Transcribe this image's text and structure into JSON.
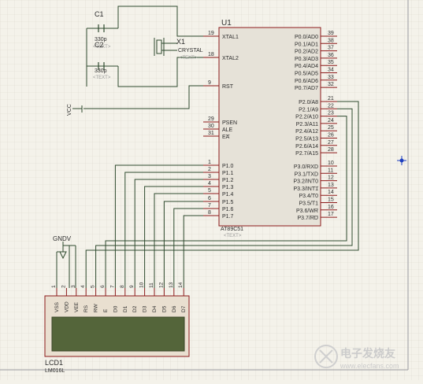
{
  "u1": {
    "ref": "U1",
    "part": "AT89C51",
    "text_placeholder": "<TEXT>",
    "left_pins": [
      {
        "num": "19",
        "name": "XTAL1"
      },
      {
        "num": "18",
        "name": "XTAL2"
      },
      {
        "num": "9",
        "name": "RST"
      },
      {
        "num": "29",
        "name": "PSEN"
      },
      {
        "num": "30",
        "name": "ALE"
      },
      {
        "num": "31",
        "name": "EA"
      },
      {
        "num": "1",
        "name": "P1.0"
      },
      {
        "num": "2",
        "name": "P1.1"
      },
      {
        "num": "3",
        "name": "P1.2"
      },
      {
        "num": "4",
        "name": "P1.3"
      },
      {
        "num": "5",
        "name": "P1.4"
      },
      {
        "num": "6",
        "name": "P1.5"
      },
      {
        "num": "7",
        "name": "P1.6"
      },
      {
        "num": "8",
        "name": "P1.7"
      }
    ],
    "right_pins": [
      {
        "num": "39",
        "name": "P0.0/AD0"
      },
      {
        "num": "38",
        "name": "P0.1/AD1"
      },
      {
        "num": "37",
        "name": "P0.2/AD2"
      },
      {
        "num": "36",
        "name": "P0.3/AD3"
      },
      {
        "num": "35",
        "name": "P0.4/AD4"
      },
      {
        "num": "34",
        "name": "P0.5/AD5"
      },
      {
        "num": "33",
        "name": "P0.6/AD6"
      },
      {
        "num": "32",
        "name": "P0.7/AD7"
      },
      {
        "num": "21",
        "name": "P2.0/A8"
      },
      {
        "num": "22",
        "name": "P2.1/A9"
      },
      {
        "num": "23",
        "name": "P2.2/A10"
      },
      {
        "num": "24",
        "name": "P2.3/A11"
      },
      {
        "num": "25",
        "name": "P2.4/A12"
      },
      {
        "num": "26",
        "name": "P2.5/A13"
      },
      {
        "num": "27",
        "name": "P2.6/A14"
      },
      {
        "num": "28",
        "name": "P2.7/A15"
      },
      {
        "num": "10",
        "name": "P3.0/RXD"
      },
      {
        "num": "11",
        "name": "P3.1/TXD"
      },
      {
        "num": "12",
        "name": "P3.2/INT0"
      },
      {
        "num": "13",
        "name": "P3.3/INT1"
      },
      {
        "num": "14",
        "name": "P3.4/T0"
      },
      {
        "num": "15",
        "name": "P3.5/T1"
      },
      {
        "num": "16",
        "name": "P3.6/WR"
      },
      {
        "num": "17",
        "name": "P3.7/RD"
      }
    ]
  },
  "c1": {
    "ref": "C1",
    "value": "330p",
    "text": "<TEXT>"
  },
  "c2": {
    "ref": "C2",
    "value": "330p",
    "text": "<TEXT>"
  },
  "x1": {
    "ref": "X1",
    "value": "CRYSTAL",
    "text": "<TEXT>"
  },
  "vcc_label": "VCC",
  "gnd_label": "GNDV",
  "lcd": {
    "ref": "LCD1",
    "part": "LM016L",
    "pins": [
      {
        "num": "1",
        "name": "VSS"
      },
      {
        "num": "2",
        "name": "VDD"
      },
      {
        "num": "3",
        "name": "VEE"
      },
      {
        "num": "4",
        "name": "RS"
      },
      {
        "num": "5",
        "name": "RW"
      },
      {
        "num": "6",
        "name": "E"
      },
      {
        "num": "7",
        "name": "D0"
      },
      {
        "num": "8",
        "name": "D1"
      },
      {
        "num": "9",
        "name": "D2"
      },
      {
        "num": "10",
        "name": "D3"
      },
      {
        "num": "11",
        "name": "D4"
      },
      {
        "num": "12",
        "name": "D5"
      },
      {
        "num": "13",
        "name": "D6"
      },
      {
        "num": "14",
        "name": "D7"
      }
    ]
  },
  "watermark": {
    "cn": "电子发烧友",
    "url": "www.elecfans.com"
  },
  "colors": {
    "background": "#f4f2ea",
    "grid": "#dcd9cd",
    "wire": "#2e4a2e",
    "chip_outline": "#8c1a1a",
    "chip_fill": "#e6e2d8",
    "lcd_bezel": "#e9dfd0",
    "lcd_screen": "#54653a",
    "pin_stub": "#8c1a1a",
    "marker": "#1e3fbf"
  }
}
